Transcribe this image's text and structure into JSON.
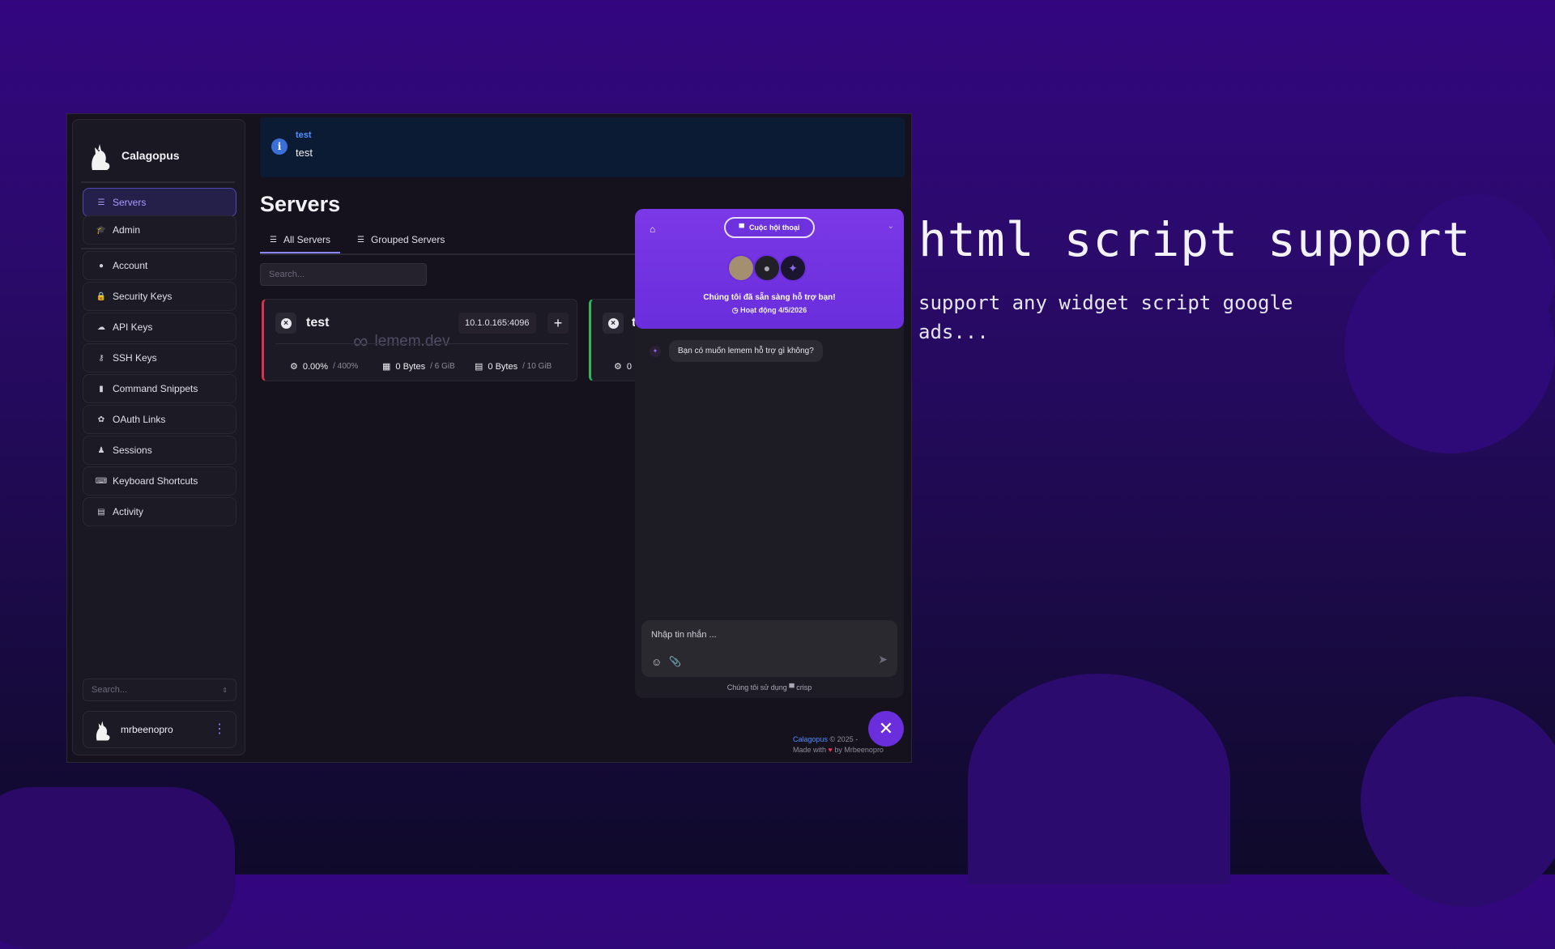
{
  "app": {
    "brand": "Calagopus",
    "sidebar": {
      "items": [
        {
          "label": "Servers",
          "icon": "server-icon"
        },
        {
          "label": "Admin",
          "icon": "graduation-cap-icon"
        },
        {
          "label": "Account",
          "icon": "user-icon"
        },
        {
          "label": "Security Keys",
          "icon": "lock-icon"
        },
        {
          "label": "API Keys",
          "icon": "cloud-icon"
        },
        {
          "label": "SSH Keys",
          "icon": "key-icon"
        },
        {
          "label": "Command Snippets",
          "icon": "clipboard-icon"
        },
        {
          "label": "OAuth Links",
          "icon": "brain-icon"
        },
        {
          "label": "Sessions",
          "icon": "person-icon"
        },
        {
          "label": "Keyboard Shortcuts",
          "icon": "keyboard-icon"
        },
        {
          "label": "Activity",
          "icon": "briefcase-icon"
        }
      ],
      "search_placeholder": "Search...",
      "user": "mrbeenopro"
    },
    "banner": {
      "title": "test",
      "text": "test"
    },
    "page_title": "Servers",
    "tabs": [
      {
        "label": "All Servers"
      },
      {
        "label": "Grouped Servers"
      }
    ],
    "search_placeholder": "Search...",
    "servers": [
      {
        "name": "test",
        "address": "10.1.0.165:4096",
        "cpu": "0.00%",
        "cpu_limit": "/ 400%",
        "memory": "0 Bytes",
        "memory_limit": "/ 6 GiB",
        "disk": "0 Bytes",
        "disk_limit": "/ 10 GiB",
        "status_color": "#d8334a"
      },
      {
        "name": "t",
        "cpu": "0",
        "status_color": "#2eb85c"
      }
    ],
    "watermark": "lemem.dev",
    "footer": {
      "brand": "Calagopus",
      "copyright": "© 2025 -",
      "made_with": "Made with",
      "by": "by Mrbeenopro"
    }
  },
  "chat": {
    "conversation_label": "Cuộc hội thoại",
    "ready_text": "Chúng tôi đã sẵn sàng hỗ trợ bạn!",
    "active_text": "Hoạt động 4/5/2026",
    "message": "Bạn có muốn lemem hỗ trợ gì không?",
    "input_placeholder": "Nhập tin nhắn ...",
    "powered_by": "Chúng tôi sử dụng",
    "powered_brand": "crisp",
    "accent": "#6a2edc"
  },
  "promo": {
    "title": "html script support",
    "subtitle": "support any widget script google ads..."
  }
}
